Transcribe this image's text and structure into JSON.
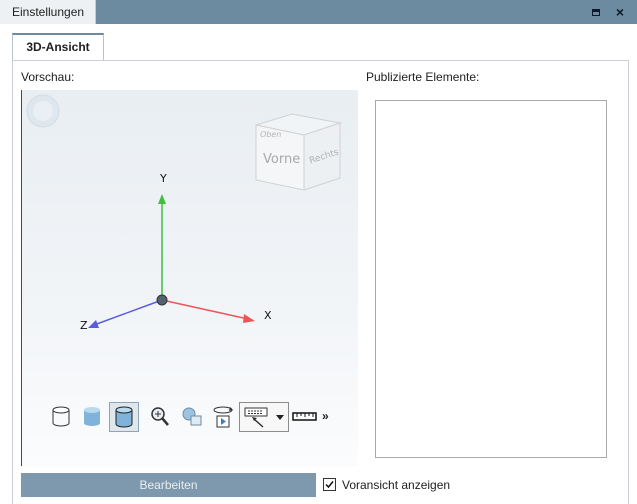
{
  "window": {
    "tab_title": "Einstellungen",
    "maximize_icon": "maximize-icon",
    "close_icon": "close-icon",
    "close_glyph": "×"
  },
  "tabs": [
    {
      "label": "3D-Ansicht",
      "selected": true
    }
  ],
  "preview": {
    "label": "Vorschau:",
    "cube_faces": {
      "front": "Vorne",
      "right": "Rechts",
      "top": "Oben"
    },
    "axes": {
      "x": "X",
      "y": "Y",
      "z": "Z"
    },
    "colors": {
      "x_axis": "#e8575a",
      "y_axis": "#3fbf3f",
      "z_axis": "#5a5ae0"
    }
  },
  "toolbar": {
    "items": [
      {
        "icon": "cylinder-outline-icon"
      },
      {
        "icon": "cylinder-shaded-icon"
      },
      {
        "icon": "cylinder-shaded-edges-icon",
        "active": true
      },
      {
        "icon": "zoom-icon"
      },
      {
        "icon": "zoom-window-icon"
      },
      {
        "icon": "rotate-icon"
      },
      {
        "icon": "view-select-icon"
      },
      {
        "icon": "measure-icon"
      }
    ],
    "more_label": "»"
  },
  "published": {
    "label": "Publizierte Elemente:",
    "items": []
  },
  "footer": {
    "edit_button": "Bearbeiten",
    "show_preview_label": "Voransicht anzeigen",
    "show_preview_checked": true,
    "check_glyph": "✓"
  },
  "colors": {
    "titlebar": "#6d8ba0",
    "button": "#7e99ad"
  }
}
